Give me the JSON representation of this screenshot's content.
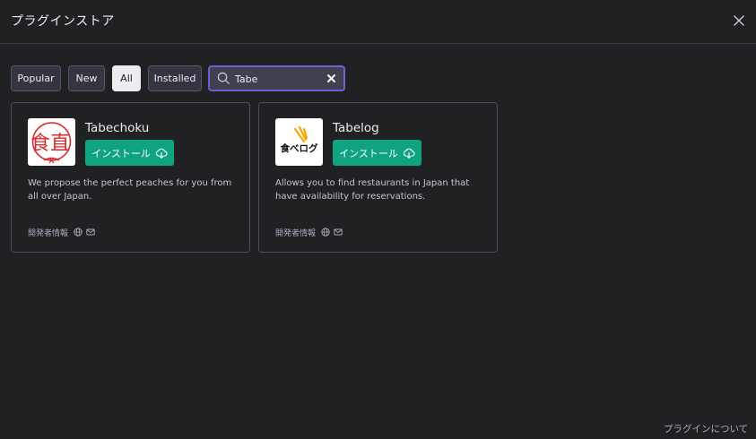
{
  "header": {
    "title": "プラグインストア",
    "close_icon": "close-icon"
  },
  "filters": [
    {
      "label": "Popular",
      "active": false
    },
    {
      "label": "New",
      "active": false
    },
    {
      "label": "All",
      "active": true
    },
    {
      "label": "Installed",
      "active": false
    }
  ],
  "search": {
    "value": "Tabe",
    "placeholder": "",
    "icon": "search-icon",
    "clear_icon": "clear-icon"
  },
  "plugins": [
    {
      "name": "Tabechoku",
      "logo_text": "食直",
      "install_label": "インストール",
      "description": "We propose the perfect peaches for you from all over Japan.",
      "developer_info": "開発者情報"
    },
    {
      "name": "Tabelog",
      "logo_text": "食べログ",
      "install_label": "インストール",
      "description": "Allows you to find restaurants in Japan that have availability for reservations.",
      "developer_info": "開発者情報"
    }
  ],
  "footer": {
    "about_plugins": "プラグインについて"
  },
  "colors": {
    "background": "#202123",
    "accent_install": "#10a37f",
    "search_border": "#6e5fd8",
    "card_border": "#4d4e57",
    "tabechoku_red": "#d92b2b"
  }
}
